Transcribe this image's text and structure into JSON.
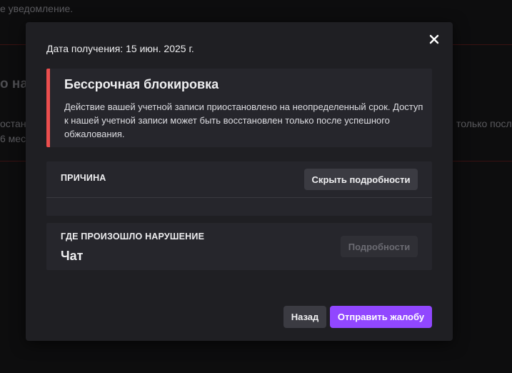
{
  "background": {
    "top_text": "е уведомление.",
    "heading_fragment": "о на",
    "left_text_1": "остан",
    "left_text_2": "6 мес",
    "right_text": "только после"
  },
  "modal": {
    "close_icon": "close-icon",
    "date_label": "Дата получения: 15 июн. 2025 г.",
    "ban": {
      "title": "Бессрочная блокировка",
      "description": "Действие вашей учетной записи приостановлено на неопределенный срок. Доступ к нашей учетной записи может быть восстановлен только после успешного обжалования.",
      "accent_color": "#eb4e4e"
    },
    "reason": {
      "heading": "ПРИЧИНА",
      "toggle_label": "Скрыть подробности"
    },
    "violation": {
      "heading": "ГДЕ ПРОИЗОШЛО НАРУШЕНИЕ",
      "value": "Чат",
      "details_label": "Подробности"
    },
    "footer": {
      "back_label": "Назад",
      "submit_label": "Отправить жалобу",
      "submit_color": "#9147ff"
    }
  }
}
